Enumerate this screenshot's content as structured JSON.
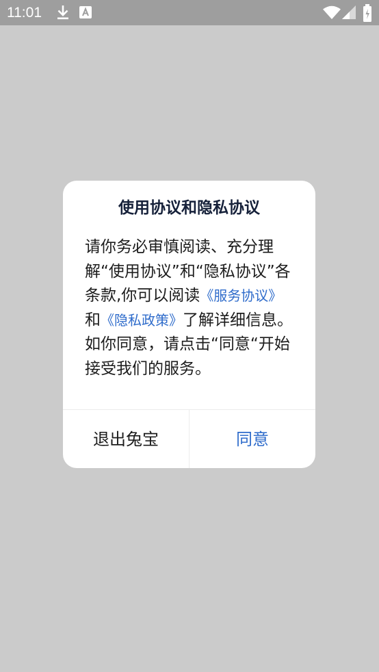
{
  "status_bar": {
    "time": "11:01",
    "icons": [
      "download-icon",
      "notification-a-icon",
      "wifi-icon",
      "signal-icon",
      "battery-icon"
    ]
  },
  "dialog": {
    "title": "使用协议和隐私协议",
    "body": {
      "part1": "请你务必审慎阅读、充分理解“使用协议”和“隐私协议”各条款,你可以阅读",
      "service_link": "《服务协议》",
      "part2": "和",
      "privacy_link": "《隐私政策》",
      "part3": "了解详细信息。如你同意，请点击“同意“开始接受我们的服务。"
    },
    "exit_label": "退出兔宝",
    "agree_label": "同意"
  },
  "colors": {
    "accent": "#2f6ccb",
    "status_bar": "#9e9e9e",
    "overlay": "#cbcbcb"
  }
}
